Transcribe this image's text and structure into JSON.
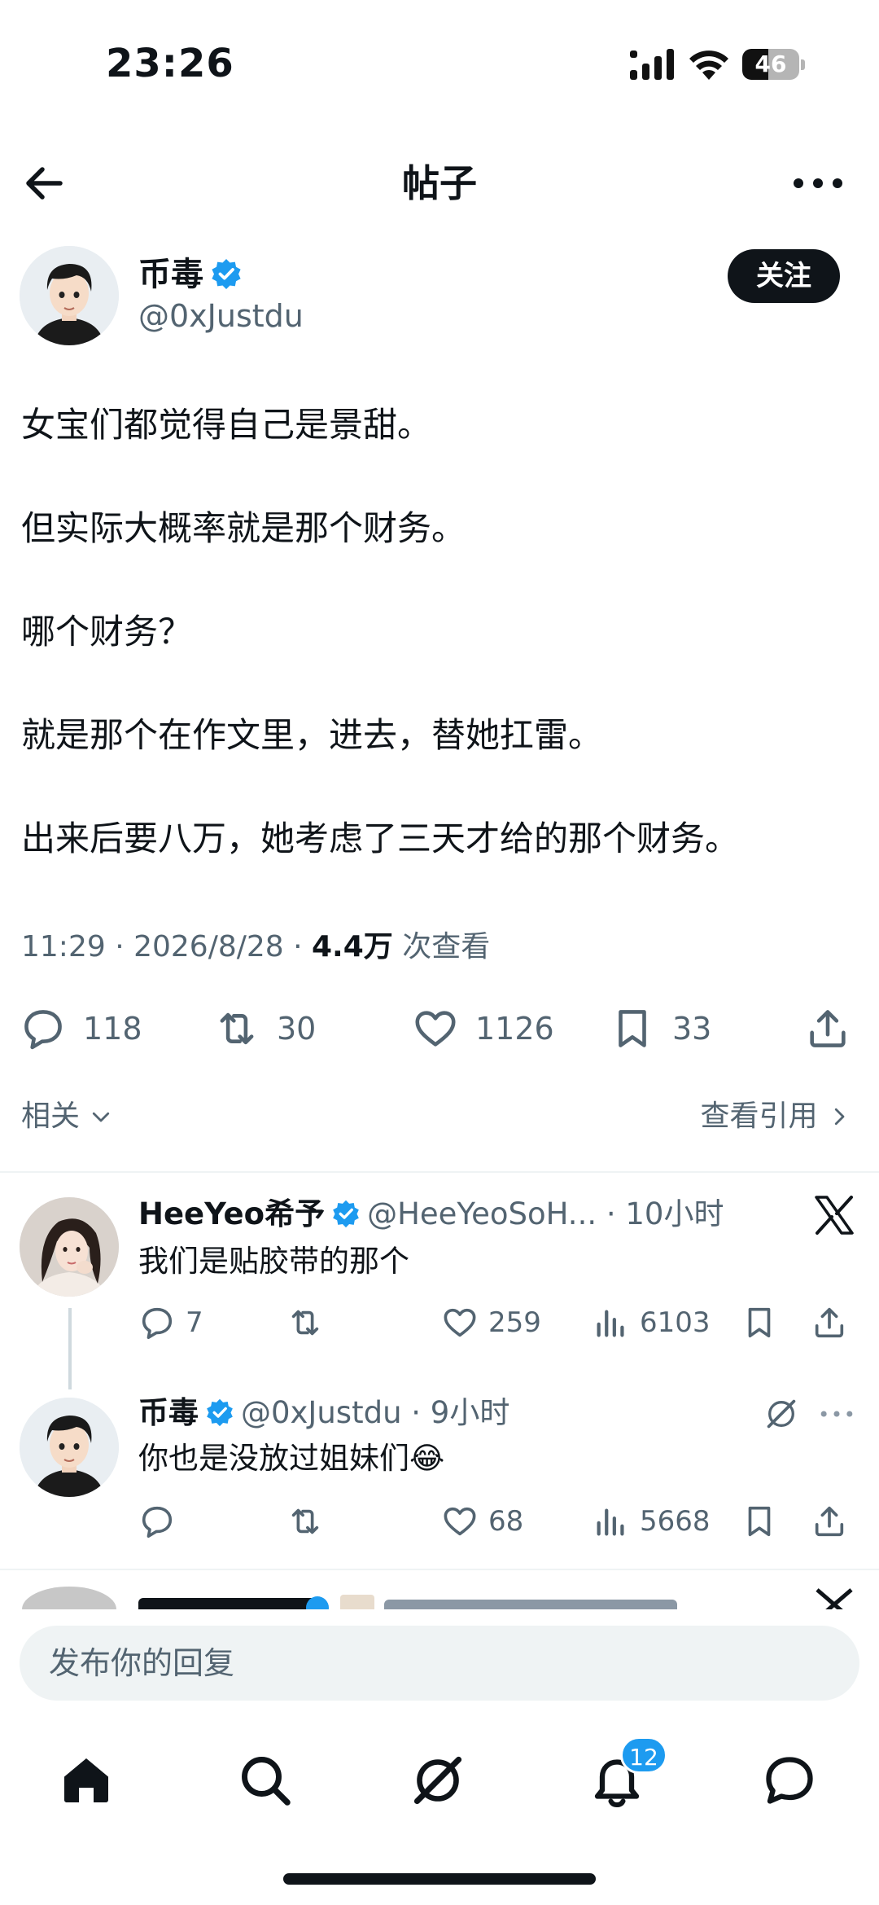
{
  "status_bar": {
    "time": "23:26",
    "battery": "46",
    "battery_level": 0.46
  },
  "header": {
    "title": "帖子"
  },
  "author": {
    "name": "币毒",
    "handle": "@0xJustdu",
    "follow_label": "关注"
  },
  "tweet": {
    "paragraphs": [
      "女宝们都觉得自己是景甜。",
      "但实际大概率就是那个财务。",
      "哪个财务？",
      "就是那个在作文里，进去，替她扛雷。",
      "出来后要八万，她考虑了三天才给的那个财务。"
    ],
    "time_date": "11:29 · 2026/8/28 · ",
    "views": "4.4万",
    "views_label": " 次查看"
  },
  "stats": {
    "replies": "118",
    "reposts": "30",
    "likes": "1126",
    "bookmarks": "33"
  },
  "links": {
    "related": "相关",
    "view_quotes": "查看引用"
  },
  "replies": [
    {
      "name": "HeeYeo希予",
      "handle": "@HeeYeoSoH... · 10小时",
      "text": "我们是贴胶带的那个",
      "comments": "7",
      "reposts": "",
      "likes": "259",
      "views": "6103"
    },
    {
      "name": "币毒",
      "handle": "@0xJustdu · 9小时",
      "text": "你也是没放过姐妹们😂",
      "comments": "",
      "reposts": "",
      "likes": "68",
      "views": "5668"
    }
  ],
  "compose": {
    "placeholder": "发布你的回复"
  },
  "nav": {
    "notification_count": "12"
  },
  "colors": {
    "accent": "#1d9bf0",
    "text": "#0f1419",
    "secondary": "#536471"
  }
}
